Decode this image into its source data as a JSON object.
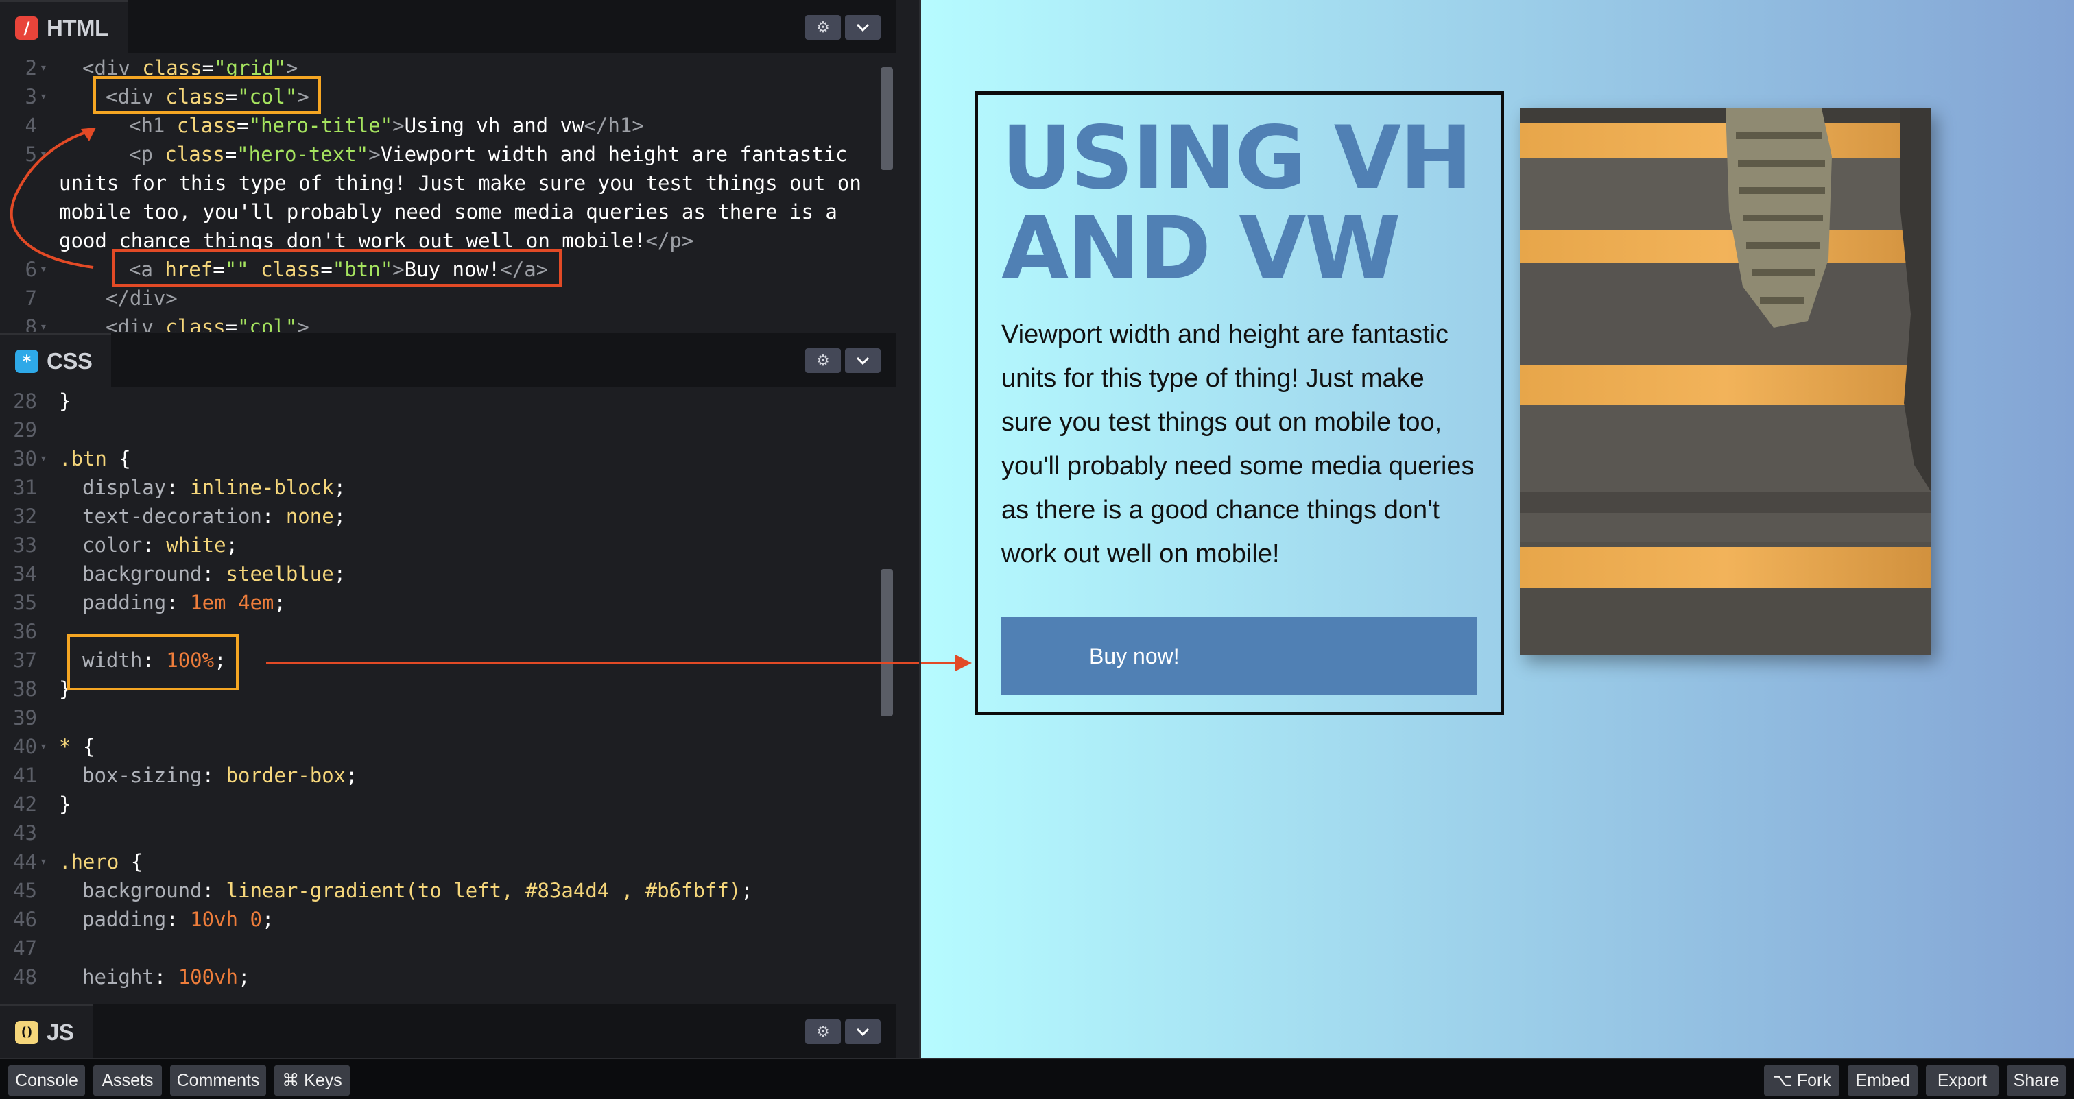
{
  "panels": {
    "html": {
      "title": "HTML",
      "icon": "/"
    },
    "css": {
      "title": "CSS",
      "icon": "*"
    },
    "js": {
      "title": "JS",
      "icon": "()"
    }
  },
  "html_code": {
    "line_numbers": [
      "2",
      "3",
      "4",
      "5",
      "",
      "",
      "",
      "6",
      "7",
      "8"
    ],
    "lines": [
      {
        "tag_open": "<div ",
        "attr": "class",
        "eq": "=",
        "str": "\"grid\"",
        "tag_close": ">"
      },
      {
        "tag_open": "<div ",
        "attr": "class",
        "eq": "=",
        "str": "\"col\"",
        "tag_close": ">"
      },
      {
        "tag_open": "<h1 ",
        "attr": "class",
        "eq": "=",
        "str": "\"hero-title\"",
        "tag_close": ">",
        "text": "Using vh and vw",
        "end": "</h1>"
      },
      {
        "tag_open": "<p ",
        "attr": "class",
        "eq": "=",
        "str": "\"hero-text\"",
        "tag_close": ">",
        "text": "Viewport width and height are fantastic"
      },
      {
        "text": "units for this type of thing! Just make sure you test things out on"
      },
      {
        "text": "mobile too, you'll probably need some media queries as there is a"
      },
      {
        "text": "good chance things don't work out well on mobile!",
        "end": "</p>"
      },
      {
        "tag_open": "<a ",
        "attr": "href",
        "eq": "=",
        "str": "\"\"",
        "attr2": " class",
        "eq2": "=",
        "str2": "\"btn\"",
        "tag_close": ">",
        "text": "Buy now!",
        "end": "</a>"
      },
      {
        "end": "</div>"
      },
      {
        "tag_open": "<div ",
        "attr": "class",
        "eq": "=",
        "str": "\"col\"",
        "tag_close": ">"
      }
    ]
  },
  "css_code": {
    "line_numbers": [
      "28",
      "29",
      "30",
      "31",
      "32",
      "33",
      "34",
      "35",
      "36",
      "37",
      "38",
      "39",
      "40",
      "41",
      "42",
      "43",
      "44",
      "45",
      "46",
      "47",
      "48"
    ],
    "lines": [
      {
        "plain": "}"
      },
      {
        "plain": ""
      },
      {
        "sel": ".btn",
        "plain": " {"
      },
      {
        "prop": "display",
        "val": "inline-block"
      },
      {
        "prop": "text-decoration",
        "val": "none"
      },
      {
        "prop": "color",
        "val": "white"
      },
      {
        "prop": "background",
        "val": "steelblue"
      },
      {
        "prop": "padding",
        "num": "1em 4em"
      },
      {
        "plain": ""
      },
      {
        "prop": "width",
        "num": "100%"
      },
      {
        "plain": "}"
      },
      {
        "plain": ""
      },
      {
        "sel": "*",
        "plain": " {"
      },
      {
        "prop": "box-sizing",
        "val": "border-box"
      },
      {
        "plain": "}"
      },
      {
        "plain": ""
      },
      {
        "sel": ".hero",
        "plain": " {"
      },
      {
        "prop": "background",
        "val": "linear-gradient(to left, #83a4d4 , #b6fbff)"
      },
      {
        "prop": "padding",
        "num": "10vh 0"
      },
      {
        "plain": ""
      },
      {
        "prop": "height",
        "num": "100vh"
      }
    ]
  },
  "preview": {
    "hero_title": "USING VH AND VW",
    "hero_text": "Viewport width and height are fantastic units for this type of thing! Just make sure you test things out on mobile too, you'll probably need some media queries as there is a good chance things don't work out well on mobile!",
    "button_label": "Buy now!",
    "gradient": [
      "#83a4d4",
      "#b6fbff"
    ],
    "accent": "#5080b4"
  },
  "bottom_bar": {
    "left": [
      "Console",
      "Assets",
      "Comments",
      "⌘ Keys"
    ],
    "right": [
      "⌥ Fork",
      "Embed",
      "Export",
      "Share"
    ]
  },
  "colors": {
    "highlight_orange": "#f5a623",
    "highlight_red": "#e24a26",
    "editor_bg": "#1d1e22"
  }
}
